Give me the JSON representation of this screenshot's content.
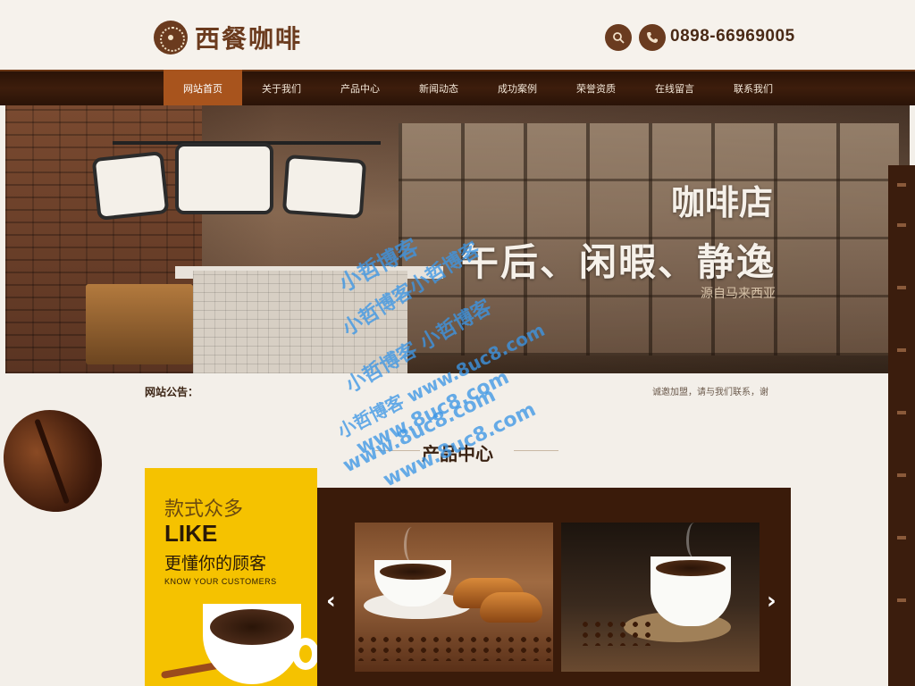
{
  "header": {
    "logo_text": "西餐咖啡",
    "phone": "0898-66969005"
  },
  "nav": {
    "items": [
      "网站首页",
      "关于我们",
      "产品中心",
      "新闻动态",
      "成功案例",
      "荣誉资质",
      "在线留言",
      "联系我们"
    ],
    "active_index": 0
  },
  "banner": {
    "title": "咖啡店",
    "slogan": "午后、闲暇、静逸",
    "subtitle": "源自马来西亚"
  },
  "notice": {
    "label": "网站公告：",
    "text": "诚邀加盟，请与我们联系，谢"
  },
  "products": {
    "section_title": "产品中心",
    "promo": {
      "line1": "款式众多",
      "line2": "LIKE",
      "line3": "更懂你的顾客",
      "line4": "KNOW YOUR CUSTOMERS"
    },
    "prev_arrow": "‹",
    "next_arrow": "›"
  },
  "watermark": {
    "line1": "小哲博客",
    "line2": "小哲博客小哲博客",
    "line3": "小哲博客 小哲博客",
    "line4": "小哲博客 www.8uc8.com",
    "line5": "www.8uc8.com",
    "line6": "www.8uc8.com",
    "line7": "www.8uc8.com"
  },
  "colors": {
    "brand_brown": "#6b3b1e",
    "nav_active": "#a8541d",
    "promo_yellow": "#f5c200"
  }
}
